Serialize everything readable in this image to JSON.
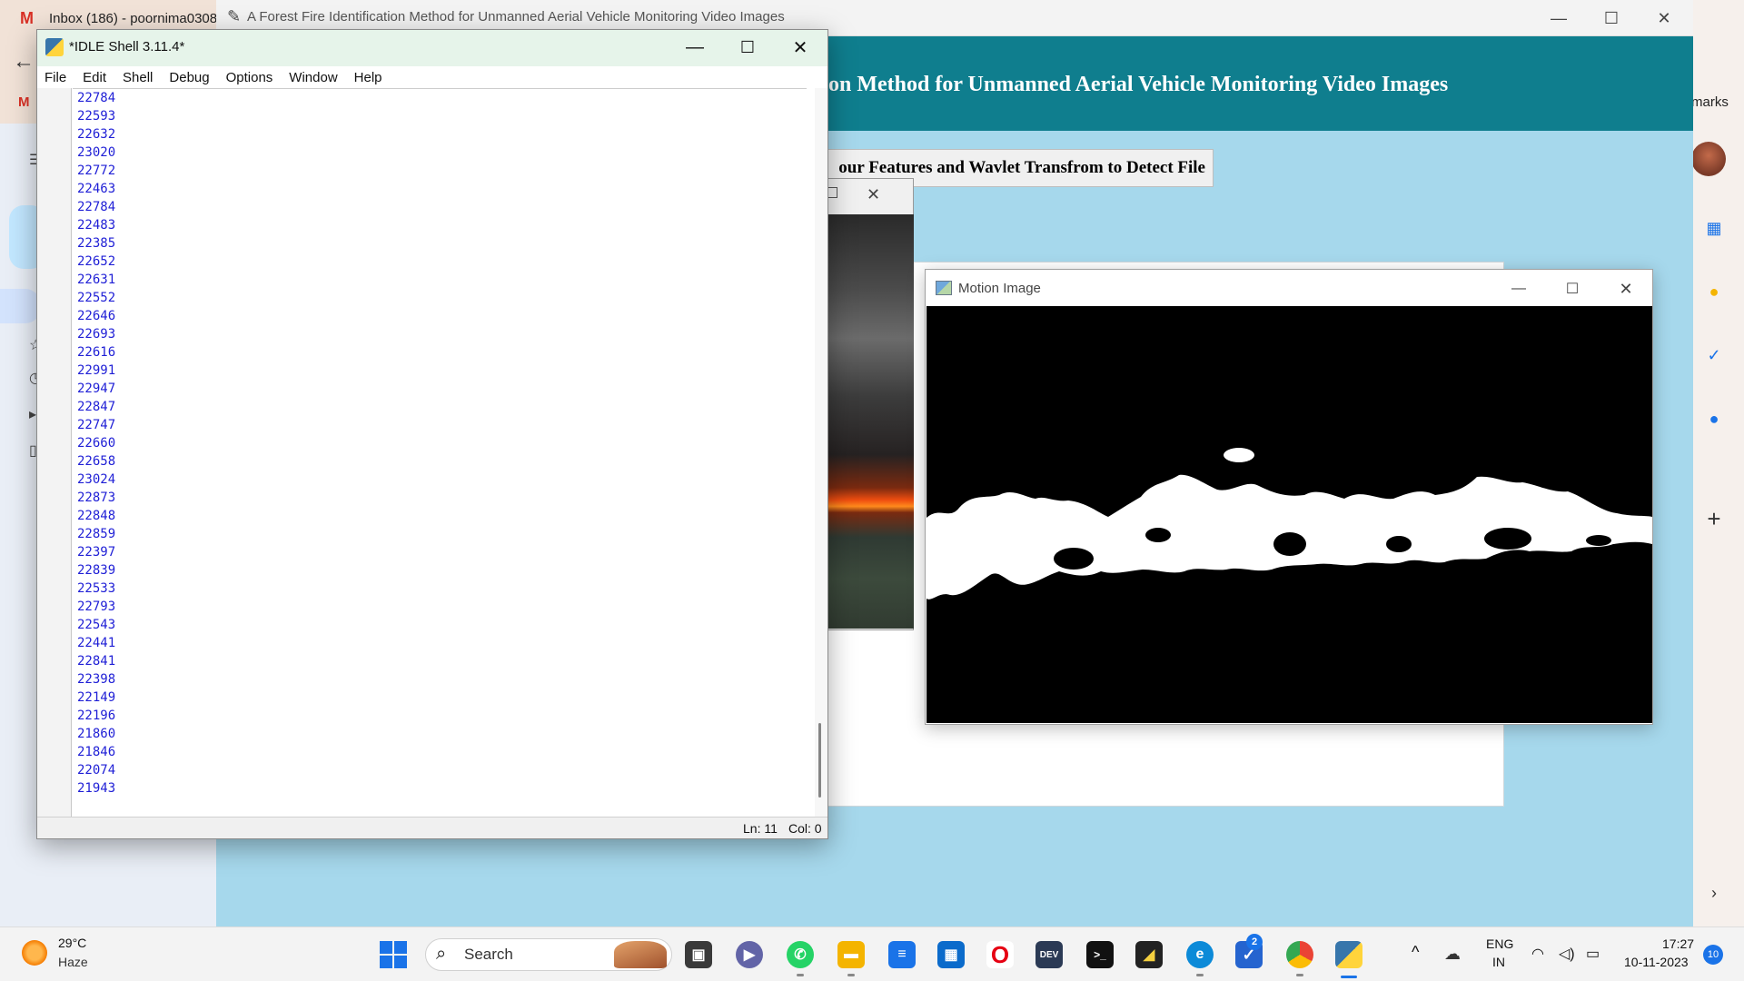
{
  "browser": {
    "tab_inbox": "Inbox (186) - poornima0308",
    "right_panel_label": "marks"
  },
  "app": {
    "title": "A Forest Fire Identification Method for Unmanned Aerial Vehicle Monitoring Video Images",
    "header_text": "on Method for Unmanned Aerial Vehicle Monitoring Video Images",
    "subtitle_button": "our Features and Wavlet Transfrom to Detect File"
  },
  "motion_window": {
    "title": "Motion Image"
  },
  "idle": {
    "title": "*IDLE Shell 3.11.4*",
    "menu": [
      "File",
      "Edit",
      "Shell",
      "Debug",
      "Options",
      "Window",
      "Help"
    ],
    "output_lines": [
      "22784",
      "22593",
      "22632",
      "23020",
      "22772",
      "22463",
      "22784",
      "22483",
      "22385",
      "22652",
      "22631",
      "22552",
      "22646",
      "22693",
      "22616",
      "22991",
      "22947",
      "22847",
      "22747",
      "22660",
      "22658",
      "23024",
      "22873",
      "22848",
      "22859",
      "22397",
      "22839",
      "22533",
      "22793",
      "22543",
      "22441",
      "22841",
      "22398",
      "22149",
      "22196",
      "21860",
      "21846",
      "22074",
      "21943"
    ],
    "status_ln": "Ln: 11",
    "status_col": "Col: 0"
  },
  "taskbar": {
    "weather_temp": "29°C",
    "weather_desc": "Haze",
    "search_label": "Search",
    "lang_line1": "ENG",
    "lang_line2": "IN",
    "time": "17:27",
    "date": "10-11-2023",
    "notification_count": "10",
    "todo_badge": "2"
  },
  "colors": {
    "app_header": "#0f7e8e",
    "app_background": "#a6d8ec",
    "idle_output_text": "#1f1fd6",
    "accent": "#1a73e8"
  }
}
